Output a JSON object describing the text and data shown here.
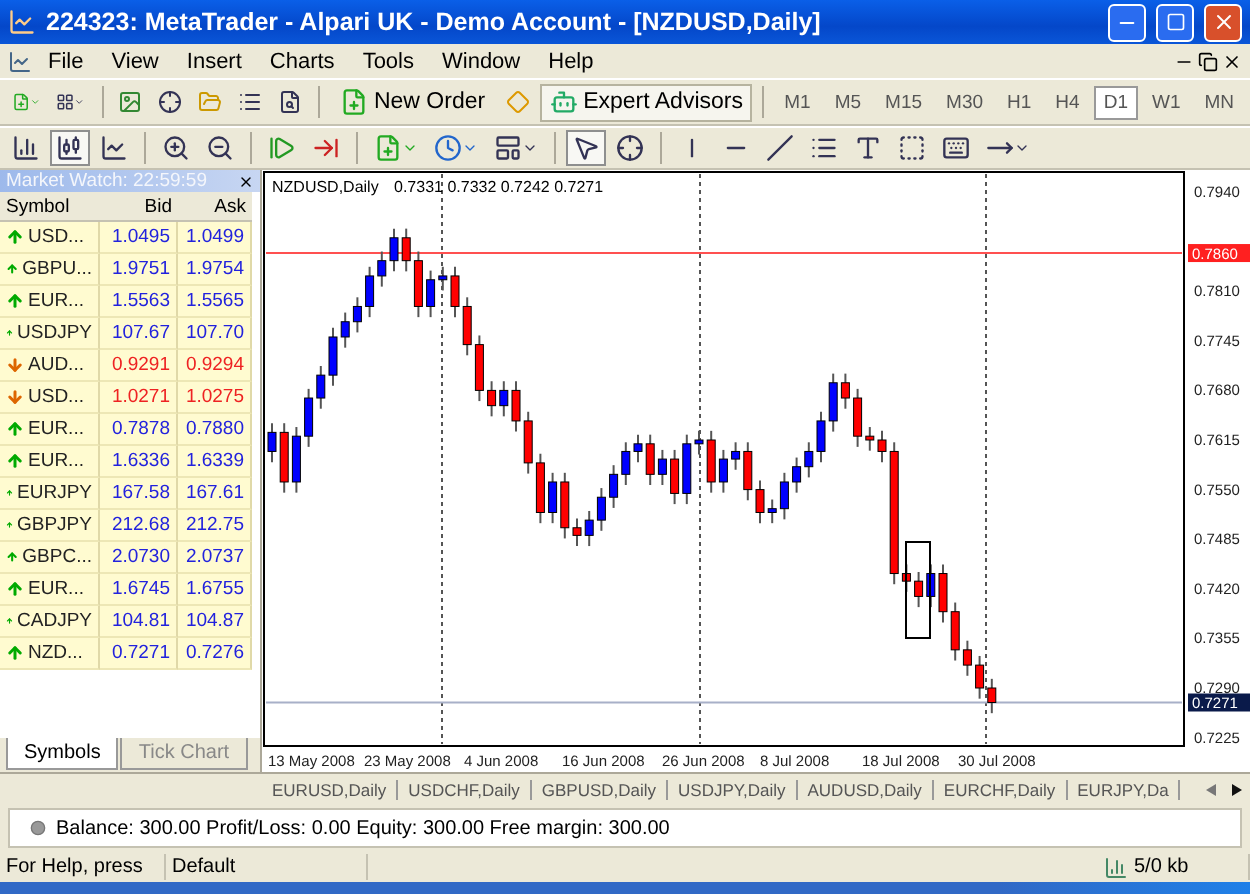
{
  "window": {
    "title": "224323: MetaTrader - Alpari UK - Demo Account - [NZDUSD,Daily]"
  },
  "menu": [
    "File",
    "View",
    "Insert",
    "Charts",
    "Tools",
    "Window",
    "Help"
  ],
  "toolbar": {
    "new_order": "New Order",
    "expert_advisors": {
      "label": "Expert Advisors",
      "active": true
    },
    "timeframes": [
      {
        "label": "M1",
        "selected": false
      },
      {
        "label": "M5",
        "selected": false
      },
      {
        "label": "M15",
        "selected": false
      },
      {
        "label": "M30",
        "selected": false
      },
      {
        "label": "H1",
        "selected": false
      },
      {
        "label": "H4",
        "selected": false
      },
      {
        "label": "D1",
        "selected": true
      },
      {
        "label": "W1",
        "selected": false
      },
      {
        "label": "MN",
        "selected": false
      }
    ]
  },
  "chart_toolbar": {
    "chart_types": [
      {
        "kind": "bars",
        "selected": false
      },
      {
        "kind": "candles",
        "selected": true
      },
      {
        "kind": "line",
        "selected": false
      }
    ],
    "cursor_tools": [
      {
        "kind": "cursor",
        "selected": true
      },
      {
        "kind": "crosshair",
        "selected": false
      }
    ]
  },
  "market_watch": {
    "title": "Market Watch: 22:59:59",
    "columns": [
      "Symbol",
      "Bid",
      "Ask"
    ],
    "rows": [
      {
        "symbol": "USD...",
        "bid": "1.0495",
        "ask": "1.0499",
        "rising": true
      },
      {
        "symbol": "GBPU...",
        "bid": "1.9751",
        "ask": "1.9754",
        "rising": true
      },
      {
        "symbol": "EUR...",
        "bid": "1.5563",
        "ask": "1.5565",
        "rising": true
      },
      {
        "symbol": "USDJPY",
        "bid": "107.67",
        "ask": "107.70",
        "rising": true
      },
      {
        "symbol": "AUD...",
        "bid": "0.9291",
        "ask": "0.9294",
        "rising": false
      },
      {
        "symbol": "USD...",
        "bid": "1.0271",
        "ask": "1.0275",
        "rising": false
      },
      {
        "symbol": "EUR...",
        "bid": "0.7878",
        "ask": "0.7880",
        "rising": true
      },
      {
        "symbol": "EUR...",
        "bid": "1.6336",
        "ask": "1.6339",
        "rising": true
      },
      {
        "symbol": "EURJPY",
        "bid": "167.58",
        "ask": "167.61",
        "rising": true
      },
      {
        "symbol": "GBPJPY",
        "bid": "212.68",
        "ask": "212.75",
        "rising": true
      },
      {
        "symbol": "GBPC...",
        "bid": "2.0730",
        "ask": "2.0737",
        "rising": true
      },
      {
        "symbol": "EUR...",
        "bid": "1.6745",
        "ask": "1.6755",
        "rising": true
      },
      {
        "symbol": "CADJPY",
        "bid": "104.81",
        "ask": "104.87",
        "rising": true
      },
      {
        "symbol": "NZD...",
        "bid": "0.7271",
        "ask": "0.7276",
        "rising": true
      }
    ],
    "tabs": [
      {
        "label": "Symbols",
        "selected": true
      },
      {
        "label": "Tick Chart",
        "selected": false
      }
    ]
  },
  "chart": {
    "symbol": "NZDUSD,Daily",
    "ohlc": "0.7331 0.7332 0.7242 0.7271",
    "price_ticks": [
      "0.7940",
      "0.7810",
      "0.7745",
      "0.7680",
      "0.7615",
      "0.7550",
      "0.7485",
      "0.7420",
      "0.7355",
      "0.7290",
      "0.7225"
    ],
    "price_line": "0.7860",
    "current_price": "0.7271",
    "date_labels": [
      "13 May 2008",
      "23 May 2008",
      "4 Jun 2008",
      "16 Jun 2008",
      "26 Jun 2008",
      "8 Jul 2008",
      "18 Jul 2008",
      "30 Jul 2008"
    ]
  },
  "chart_tabs": [
    "EURUSD,Daily",
    "USDCHF,Daily",
    "GBPUSD,Daily",
    "USDJPY,Daily",
    "AUDUSD,Daily",
    "EURCHF,Daily",
    "EURJPY,Da"
  ],
  "terminal": {
    "summary": "Balance: 300.00 Profit/Loss: 0.00 Equity: 300.00 Free margin: 300.00"
  },
  "status_bar": {
    "help": "For Help, press",
    "profile": "Default",
    "traffic": "5/0 kb"
  }
}
